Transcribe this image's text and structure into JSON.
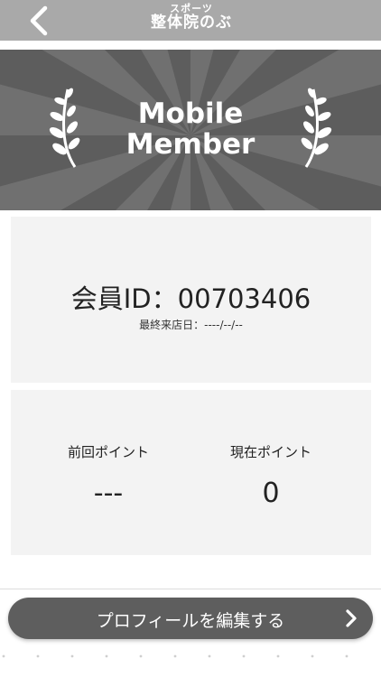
{
  "header": {
    "back_icon": "chevron-left-icon",
    "logo_line1": "スポーツ",
    "logo_line2": "整体院のぶ"
  },
  "banner": {
    "title_line1": "Mobile",
    "title_line2": "Member",
    "decoration_icon": "laurel-icon"
  },
  "member": {
    "id_text": "会員ID：00703406",
    "last_visit": "最終来店日：----/--/--"
  },
  "points": {
    "previous_label": "前回ポイント",
    "previous_value": "---",
    "current_label": "現在ポイント",
    "current_value": "0"
  },
  "footer": {
    "edit_profile_label": "プロフィールを編集する",
    "arrow_icon": "chevron-right-icon"
  },
  "colors": {
    "header_bg": "#a9a9a9",
    "banner_bg": "#5d5d5d",
    "card_bg": "#f3f3f3",
    "button_bg": "#5e5e5e"
  }
}
